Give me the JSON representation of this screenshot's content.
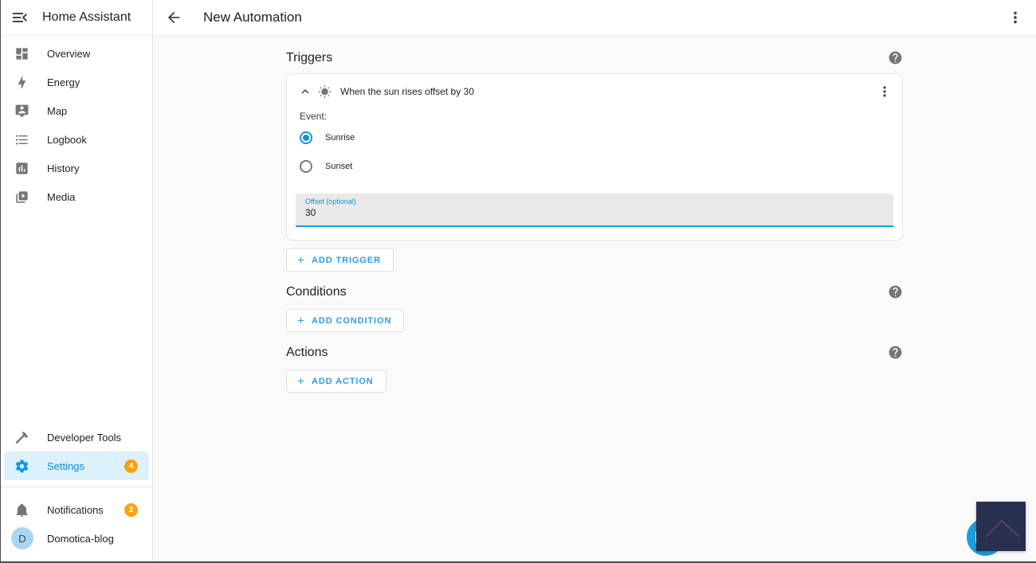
{
  "app_title": "Home Assistant",
  "page": {
    "title": "New Automation"
  },
  "sidebar": {
    "items": [
      {
        "label": "Overview"
      },
      {
        "label": "Energy"
      },
      {
        "label": "Map"
      },
      {
        "label": "Logbook"
      },
      {
        "label": "History"
      },
      {
        "label": "Media"
      }
    ],
    "developer_tools": {
      "label": "Developer Tools"
    },
    "settings": {
      "label": "Settings",
      "badge": "4"
    },
    "notifications": {
      "label": "Notifications",
      "badge": "2"
    },
    "profile": {
      "label": "Domotica-blog",
      "avatar_letter": "D"
    }
  },
  "sections": {
    "triggers": {
      "title": "Triggers",
      "add_button": "ADD TRIGGER"
    },
    "conditions": {
      "title": "Conditions",
      "add_button": "ADD CONDITION"
    },
    "actions": {
      "title": "Actions",
      "add_button": "ADD ACTION"
    }
  },
  "trigger_card": {
    "title": "When the sun rises offset by 30",
    "event_label": "Event:",
    "options": [
      {
        "label": "Sunrise",
        "selected": true
      },
      {
        "label": "Sunset",
        "selected": false
      }
    ],
    "offset_field": {
      "label": "Offset (optional)",
      "value": "30"
    }
  },
  "colors": {
    "accent_blue": "#03a9f4",
    "button_blue": "#2e9be5",
    "badge_orange": "#f9a20c",
    "selected_item_bg": "#dcf1fc",
    "logo_navy": "#27304f",
    "chat_blue": "#1c9ede"
  }
}
